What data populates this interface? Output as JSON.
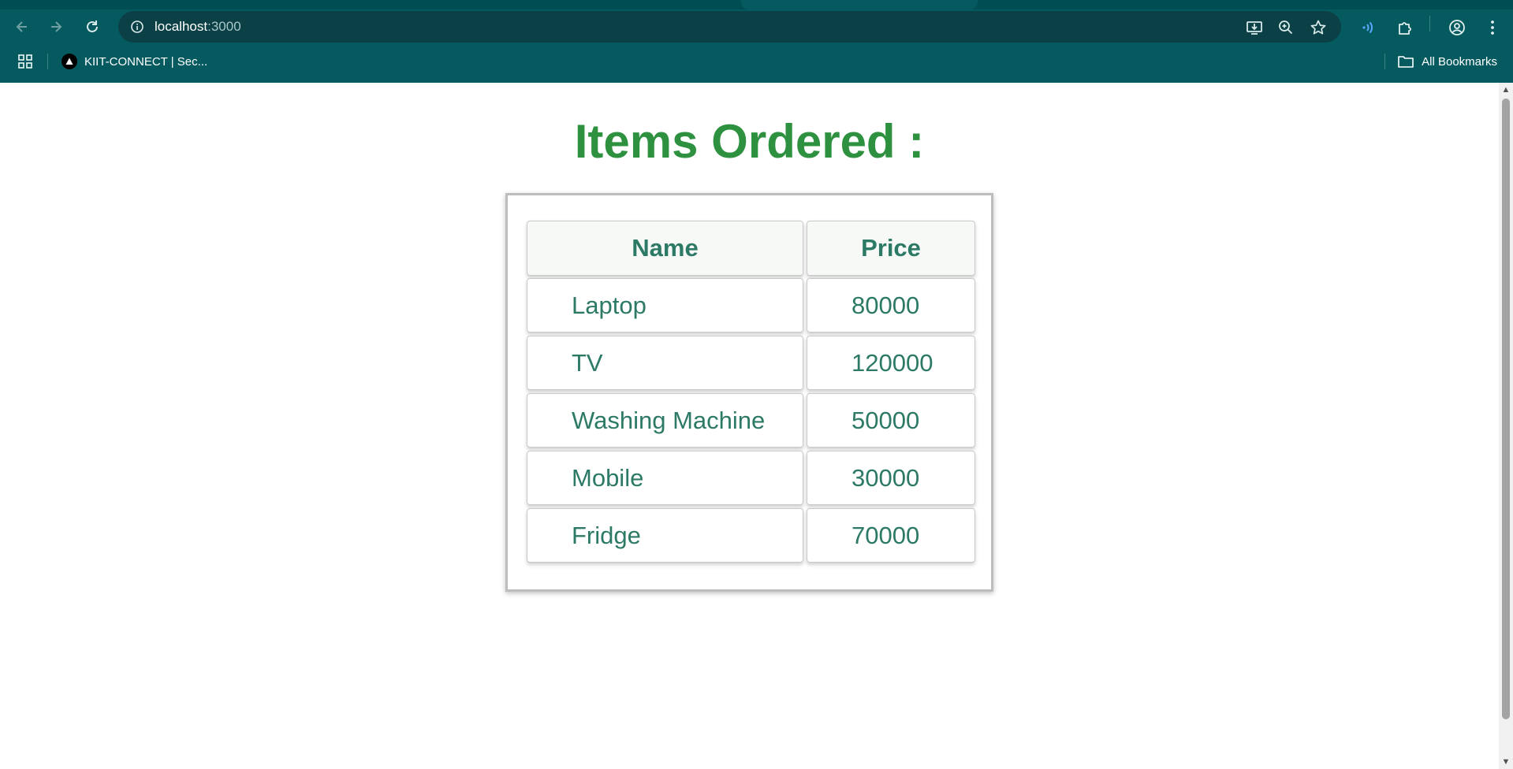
{
  "browser": {
    "url_host": "localhost",
    "url_port": ":3000",
    "bookmarks": [
      {
        "label": "KIIT-CONNECT | Sec..."
      }
    ],
    "all_bookmarks_label": "All Bookmarks",
    "icons": {
      "back": "arrow-left-icon",
      "forward": "arrow-right-icon",
      "reload": "reload-icon",
      "site_info": "info-icon",
      "install": "install-app-icon",
      "zoom": "zoom-icon",
      "bookmark_star": "star-icon",
      "extension_active": "broadcast-icon",
      "extensions": "puzzle-icon",
      "profile": "profile-icon",
      "menu": "kebab-menu-icon",
      "apps": "apps-grid-icon",
      "folder": "folder-icon"
    },
    "theme_color": "#055a60"
  },
  "page": {
    "title": "Items Ordered :",
    "title_color": "#2e9140",
    "text_color": "#2c7a66",
    "table": {
      "headers": [
        "Name",
        "Price"
      ],
      "rows": [
        {
          "name": "Laptop",
          "price": "80000"
        },
        {
          "name": "TV",
          "price": "120000"
        },
        {
          "name": "Washing Machine",
          "price": "50000"
        },
        {
          "name": "Mobile",
          "price": "30000"
        },
        {
          "name": "Fridge",
          "price": "70000"
        }
      ]
    }
  }
}
